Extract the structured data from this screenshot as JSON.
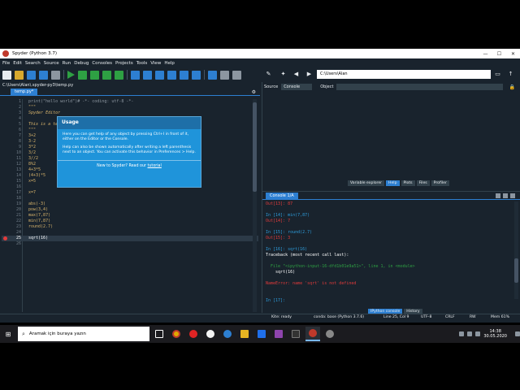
{
  "window": {
    "title": "Spyder (Python 3.7)",
    "minimize": "—",
    "maximize": "☐",
    "close": "✕"
  },
  "menu": [
    "File",
    "Edit",
    "Search",
    "Source",
    "Run",
    "Debug",
    "Consoles",
    "Projects",
    "Tools",
    "View",
    "Help"
  ],
  "toolbar": {
    "path": "C:\\Users\\Alan",
    "back": "◀",
    "forward": "▶"
  },
  "editor": {
    "path": "C:\\Users\\Alan\\.spyder-py3\\temp.py",
    "tab": "temp.py*",
    "current_line": "25",
    "lines": [
      {
        "n": "1",
        "t": "print(\"hello world\")# -*- coding: utf-8 -*-"
      },
      {
        "n": "2",
        "t": "\"\"\""
      },
      {
        "n": "3",
        "t": "Spyder Editor"
      },
      {
        "n": "4",
        "t": ""
      },
      {
        "n": "5",
        "t": "This is a temporary script file."
      },
      {
        "n": "6",
        "t": "\"\"\""
      },
      {
        "n": "7",
        "t": "3+2"
      },
      {
        "n": "8",
        "t": "3-2"
      },
      {
        "n": "9",
        "t": "3*2"
      },
      {
        "n": "10",
        "t": "3/2"
      },
      {
        "n": "11",
        "t": "3//2"
      },
      {
        "n": "12",
        "t": "8%2"
      },
      {
        "n": "13",
        "t": "4+3*5"
      },
      {
        "n": "14",
        "t": "(4+3)*5"
      },
      {
        "n": "15",
        "t": "x=5"
      },
      {
        "n": "16",
        "t": ""
      },
      {
        "n": "17",
        "t": "x=7"
      },
      {
        "n": "18",
        "t": ""
      },
      {
        "n": "19",
        "t": "abs(-3)"
      },
      {
        "n": "20",
        "t": "pow(3,4)"
      },
      {
        "n": "21",
        "t": "max(7,87)"
      },
      {
        "n": "22",
        "t": "min(7,87)"
      },
      {
        "n": "23",
        "t": "round(2.7)"
      },
      {
        "n": "24",
        "t": ""
      },
      {
        "n": "25",
        "t": "sqrt(16)"
      },
      {
        "n": "26",
        "t": ""
      }
    ]
  },
  "help": {
    "source_label": "Source",
    "source_value": "Console",
    "object_label": "Object",
    "usage_title": "Usage",
    "usage_p1": "Here you can get help of any object by pressing Ctrl+I in front of it, either on the Editor or the Console.",
    "usage_p2": "Help can also be shown automatically after writing a left parenthesis next to an object. You can activate this behavior in Preferences > Help.",
    "usage_foot_prefix": "New to Spyder? Read our ",
    "usage_foot_link": "tutorial",
    "tabs": [
      "Variable explorer",
      "Help",
      "Plots",
      "Files",
      "Profiler"
    ]
  },
  "console": {
    "tab": "Console 1/A",
    "lines": [
      {
        "cls": "out",
        "t": "Out[13]: 87"
      },
      {
        "cls": "",
        "t": ""
      },
      {
        "cls": "in",
        "t": "In [14]: min(7,87)"
      },
      {
        "cls": "out",
        "t": "Out[14]: 7"
      },
      {
        "cls": "",
        "t": ""
      },
      {
        "cls": "in",
        "t": "In [15]: round(2.7)"
      },
      {
        "cls": "out",
        "t": "Out[15]: 3"
      },
      {
        "cls": "",
        "t": ""
      },
      {
        "cls": "in",
        "t": "In [16]: sqrt(16)"
      },
      {
        "cls": "",
        "t": "Traceback (most recent call last):"
      },
      {
        "cls": "",
        "t": ""
      },
      {
        "cls": "tb-file",
        "t": "  File \"<ipython-input-16-dfd1b01e9a51>\", line 1, in <module>"
      },
      {
        "cls": "",
        "t": "    sqrt(16)"
      },
      {
        "cls": "",
        "t": ""
      },
      {
        "cls": "err",
        "t": "NameError: name 'sqrt' is not defined"
      },
      {
        "cls": "",
        "t": ""
      },
      {
        "cls": "",
        "t": ""
      },
      {
        "cls": "in",
        "t": "In [17]:"
      }
    ],
    "tabs": [
      "IPython console",
      "History"
    ]
  },
  "status": {
    "kite": "Kite: ready",
    "conda": "conda: base (Python 3.7.6)",
    "position": "Line 25, Col 9",
    "encoding": "UTF-8",
    "eol": "CRLF",
    "rw": "RW",
    "mem": "Mem 61%"
  },
  "taskbar": {
    "search_placeholder": "Aramak için buraya yazın",
    "time": "14:38",
    "date": "30.05.2020"
  }
}
